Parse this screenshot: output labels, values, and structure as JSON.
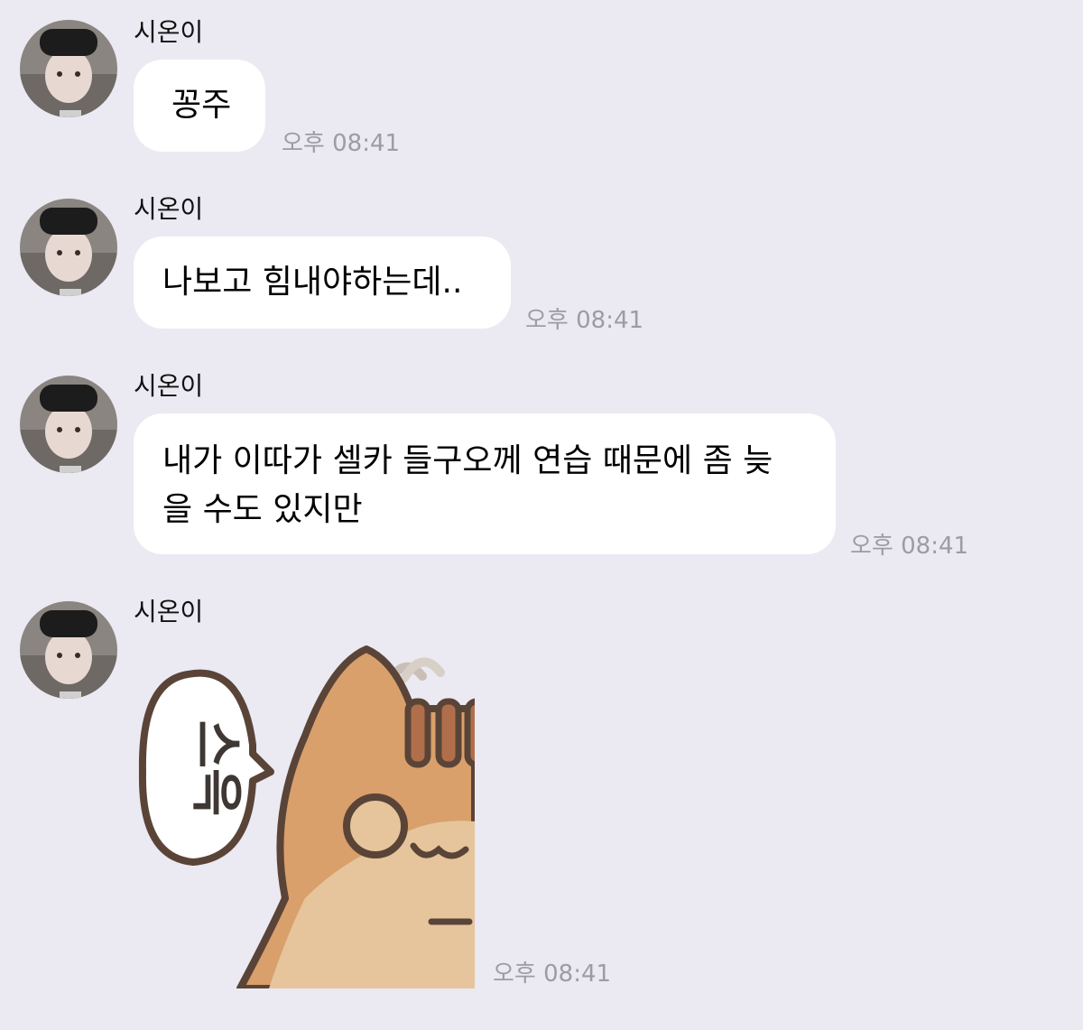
{
  "sender_name": "시온이",
  "messages": [
    {
      "text": "꽁주",
      "time": "오후 08:41"
    },
    {
      "text": "나보고 힘내야하는데..",
      "time": "오후 08:41"
    },
    {
      "lines": [
        "내가 이따가 셀카 들구오께 연습 때문에 좀 늦",
        "을 수도 있지만"
      ],
      "time": "오후 08:41"
    },
    {
      "sticker": {
        "bubble_text": "스윽",
        "description_icon": "cat-sticker"
      },
      "time": "오후 08:41"
    }
  ],
  "colors": {
    "background": "#ebe9f2",
    "bubble": "#ffffff",
    "timestamp": "#9c9ca3",
    "cat_body": "#d9a06b",
    "cat_belly": "#e9c79f",
    "cat_outline": "#5a4438"
  }
}
